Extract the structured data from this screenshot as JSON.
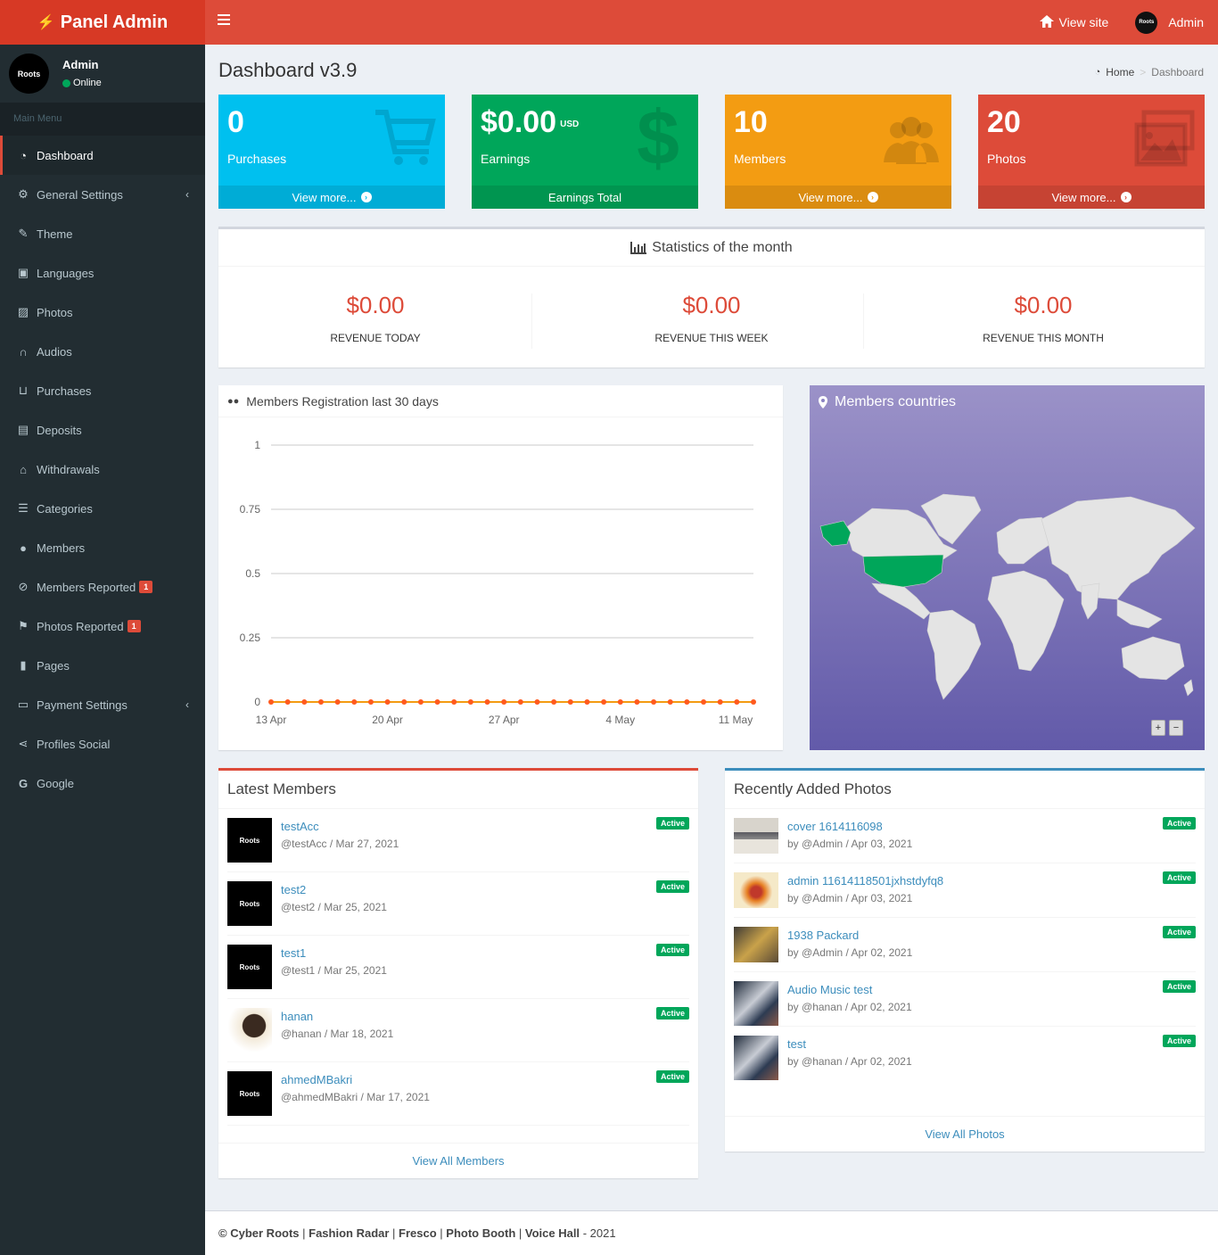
{
  "brand": {
    "title": "Panel Admin"
  },
  "topbar": {
    "view_site": "View site",
    "admin": "Admin"
  },
  "user": {
    "avatar_text": "Roots",
    "name": "Admin",
    "status": "Online"
  },
  "sidebar": {
    "header": "Main Menu",
    "items": [
      {
        "label": "Dashboard",
        "icon": "dashboard-icon"
      },
      {
        "label": "General Settings",
        "icon": "gears-icon"
      },
      {
        "label": "Theme",
        "icon": "paint-brush-icon"
      },
      {
        "label": "Languages",
        "icon": "language-icon"
      },
      {
        "label": "Photos",
        "icon": "image-icon"
      },
      {
        "label": "Audios",
        "icon": "headphones-icon"
      },
      {
        "label": "Purchases",
        "icon": "cart-icon"
      },
      {
        "label": "Deposits",
        "icon": "money-icon"
      },
      {
        "label": "Withdrawals",
        "icon": "bank-icon"
      },
      {
        "label": "Categories",
        "icon": "list-icon"
      },
      {
        "label": "Members",
        "icon": "user-icon"
      },
      {
        "label": "Members Reported",
        "icon": "ban-icon",
        "badge": "1"
      },
      {
        "label": "Photos Reported",
        "icon": "flag-icon",
        "badge": "1"
      },
      {
        "label": "Pages",
        "icon": "file-icon"
      },
      {
        "label": "Payment Settings",
        "icon": "credit-card-icon"
      },
      {
        "label": "Profiles Social",
        "icon": "share-icon"
      },
      {
        "label": "Google",
        "icon": "google-icon"
      }
    ]
  },
  "page": {
    "title": "Dashboard v3.9"
  },
  "breadcrumb": {
    "home": "Home",
    "current": "Dashboard"
  },
  "boxes": [
    {
      "value": "0",
      "label": "Purchases",
      "footer": "View more...",
      "color": "#00c0ef"
    },
    {
      "value": "$0.00",
      "unit": "USD",
      "label": "Earnings",
      "footer": "Earnings Total",
      "color": "#00a65a"
    },
    {
      "value": "10",
      "label": "Members",
      "footer": "View more...",
      "color": "#f39c12"
    },
    {
      "value": "20",
      "label": "Photos",
      "footer": "View more...",
      "color": "#dd4b39"
    }
  ],
  "stats": {
    "title": "Statistics of the month",
    "items": [
      {
        "value": "$0.00",
        "label": "REVENUE TODAY"
      },
      {
        "value": "$0.00",
        "label": "REVENUE THIS WEEK"
      },
      {
        "value": "$0.00",
        "label": "REVENUE THIS MONTH"
      }
    ]
  },
  "registration_chart": {
    "title": "Members Registration last 30 days"
  },
  "chart_data": {
    "type": "line",
    "title": "Members Registration last 30 days",
    "xlabel": "",
    "ylabel": "",
    "x_ticks": [
      "13 Apr",
      "20 Apr",
      "27 Apr",
      "4 May",
      "11 May"
    ],
    "y_ticks": [
      "1",
      "0.75",
      "0.5",
      "0.25",
      "0"
    ],
    "ylim": [
      0,
      1
    ],
    "points": 30,
    "values": [
      0,
      0,
      0,
      0,
      0,
      0,
      0,
      0,
      0,
      0,
      0,
      0,
      0,
      0,
      0,
      0,
      0,
      0,
      0,
      0,
      0,
      0,
      0,
      0,
      0,
      0,
      0,
      0,
      0,
      0
    ],
    "color": "#f56954",
    "grid": true
  },
  "map": {
    "title": "Members countries",
    "highlight_color": "#00a65a",
    "zoom_in": "+",
    "zoom_out": "−"
  },
  "latest_members": {
    "title": "Latest Members",
    "view_all": "View All Members",
    "items": [
      {
        "name": "testAcc",
        "meta": "@testAcc / Mar 27, 2021",
        "status": "Active",
        "thumb": "Roots"
      },
      {
        "name": "test2",
        "meta": "@test2 / Mar 25, 2021",
        "status": "Active",
        "thumb": "Roots"
      },
      {
        "name": "test1",
        "meta": "@test1 / Mar 25, 2021",
        "status": "Active",
        "thumb": "Roots"
      },
      {
        "name": "hanan",
        "meta": "@hanan / Mar 18, 2021",
        "status": "Active",
        "thumb": ""
      },
      {
        "name": "ahmedMBakri",
        "meta": "@ahmedMBakri / Mar 17, 2021",
        "status": "Active",
        "thumb": "Roots"
      }
    ]
  },
  "recent_photos": {
    "title": "Recently Added Photos",
    "view_all": "View All Photos",
    "items": [
      {
        "title": "cover 1614116098",
        "meta": "by @Admin / Apr 03, 2021",
        "status": "Active"
      },
      {
        "title": "admin 11614118501jxhstdyfq8",
        "meta": "by @Admin / Apr 03, 2021",
        "status": "Active"
      },
      {
        "title": "1938 Packard",
        "meta": "by @Admin / Apr 02, 2021",
        "status": "Active"
      },
      {
        "title": "Audio Music test",
        "meta": "by @hanan / Apr 02, 2021",
        "status": "Active"
      },
      {
        "title": "test",
        "meta": "by @hanan / Apr 02, 2021",
        "status": "Active"
      }
    ]
  },
  "footer": {
    "copy": "©",
    "links": [
      "Cyber Roots",
      "Fashion Radar",
      "Fresco",
      "Photo Booth",
      "Voice Hall"
    ],
    "year": "- 2021"
  }
}
